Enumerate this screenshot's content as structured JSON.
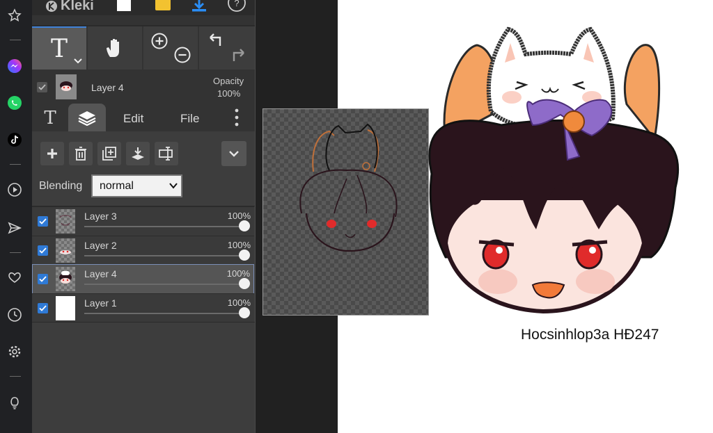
{
  "app": {
    "logo_text": "Kleki"
  },
  "layer_panel": {
    "current_layer_name": "Layer 4",
    "opacity_label": "Opacity",
    "opacity_value": "100%"
  },
  "tabs": [
    {
      "label": "T"
    },
    {
      "label": "layers"
    },
    {
      "label": "Edit"
    },
    {
      "label": "File"
    }
  ],
  "blending": {
    "label": "Blending",
    "value": "normal"
  },
  "layers": [
    {
      "name": "Layer 3",
      "opacity": "100%",
      "opacity_value": 1.0,
      "visible": true,
      "selected": false
    },
    {
      "name": "Layer 2",
      "opacity": "100%",
      "opacity_value": 1.0,
      "visible": true,
      "selected": false
    },
    {
      "name": "Layer 4",
      "opacity": "100%",
      "opacity_value": 1.0,
      "visible": true,
      "selected": true
    },
    {
      "name": "Layer 1",
      "opacity": "100%",
      "opacity_value": 1.0,
      "visible": true,
      "selected": false
    }
  ],
  "canvas": {
    "signature_text": "Hocsinhlop3a HĐ247"
  },
  "colors": {
    "accent_blue": "#2f7ad6",
    "panel_bg": "#333333",
    "sidebar_bg": "#202124",
    "whatsapp_green": "#25d366",
    "cat_orange": "#f4a261",
    "bow_purple": "#8e6bc9",
    "hair_dark": "#2a141c",
    "eye_red": "#e02b2b"
  },
  "sidebar_icons": [
    "pin-icon",
    "messenger-icon",
    "whatsapp-icon",
    "tiktok-icon",
    "play-icon",
    "send-icon",
    "heart-icon",
    "clock-icon",
    "gear-icon",
    "bulb-icon"
  ]
}
